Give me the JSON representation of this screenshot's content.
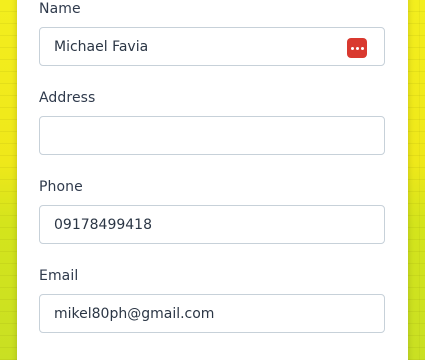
{
  "form": {
    "name": {
      "label": "Name",
      "value": "Michael Favia",
      "icon": "password-manager-icon"
    },
    "address": {
      "label": "Address",
      "value": ""
    },
    "phone": {
      "label": "Phone",
      "value": "09178499418"
    },
    "email": {
      "label": "Email",
      "value": "mikel80ph@gmail.com"
    }
  },
  "colors": {
    "background_top": "#f3ee1e",
    "background_bottom": "#c9e023",
    "card": "#ffffff",
    "input_border": "#c7d1d9",
    "icon_red": "#d9392f",
    "label_text": "#2f3a4c"
  }
}
